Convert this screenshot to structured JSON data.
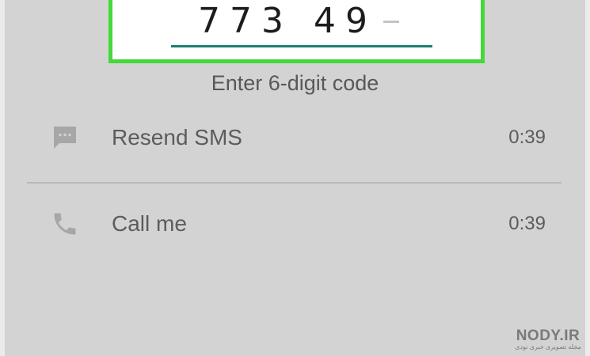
{
  "verification": {
    "code_digits": "773 49",
    "hint": "Enter 6-digit code"
  },
  "options": [
    {
      "label": "Resend SMS",
      "timer": "0:39",
      "icon": "message-icon"
    },
    {
      "label": "Call me",
      "timer": "0:39",
      "icon": "phone-icon"
    }
  ],
  "watermark": {
    "brand": "NODY.IR",
    "subtitle": "مجله تصویری خبری نودی"
  },
  "colors": {
    "highlight": "#45d83a",
    "underline": "#1e7f72",
    "screen_bg": "#d3d3d3",
    "text": "#5c5c5c"
  }
}
